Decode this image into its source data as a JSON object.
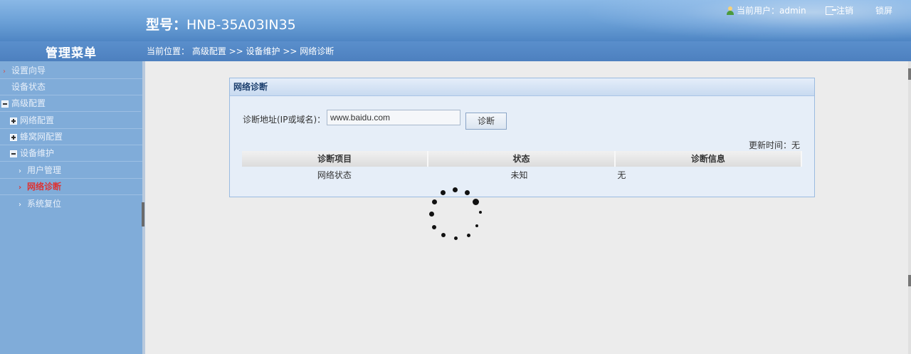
{
  "header": {
    "model_label": "型号：",
    "model_value": "HNB-35A03IN35",
    "current_user_label": "当前用户：",
    "current_user": "admin",
    "logout": "注销",
    "lock_screen": "锁屏"
  },
  "sidebar": {
    "title": "管理菜单",
    "items": [
      {
        "label": "设置向导"
      },
      {
        "label": "设备状态"
      },
      {
        "label": "高级配置"
      },
      {
        "label": "网络配置"
      },
      {
        "label": "蜂窝网配置"
      },
      {
        "label": "设备维护"
      },
      {
        "label": "用户管理"
      },
      {
        "label": "网络诊断"
      },
      {
        "label": "系统复位"
      }
    ]
  },
  "breadcrumb": {
    "text": "当前位置： 高级配置 >> 设备维护 >> 网络诊断"
  },
  "panel": {
    "title": "网络诊断",
    "address_label": "诊断地址(IP或域名)：",
    "address_value": "www.baidu.com",
    "diagnose_button": "诊断",
    "update_time": "更新时间：无",
    "columns": [
      "诊断项目",
      "状态",
      "诊断信息"
    ],
    "rows": [
      {
        "item": "网络状态",
        "status": "未知",
        "info": "无"
      }
    ]
  },
  "colors": {
    "accent": "#4f86c4",
    "sidebar_bg": "#80acd9",
    "active_item": "#dd3333"
  }
}
